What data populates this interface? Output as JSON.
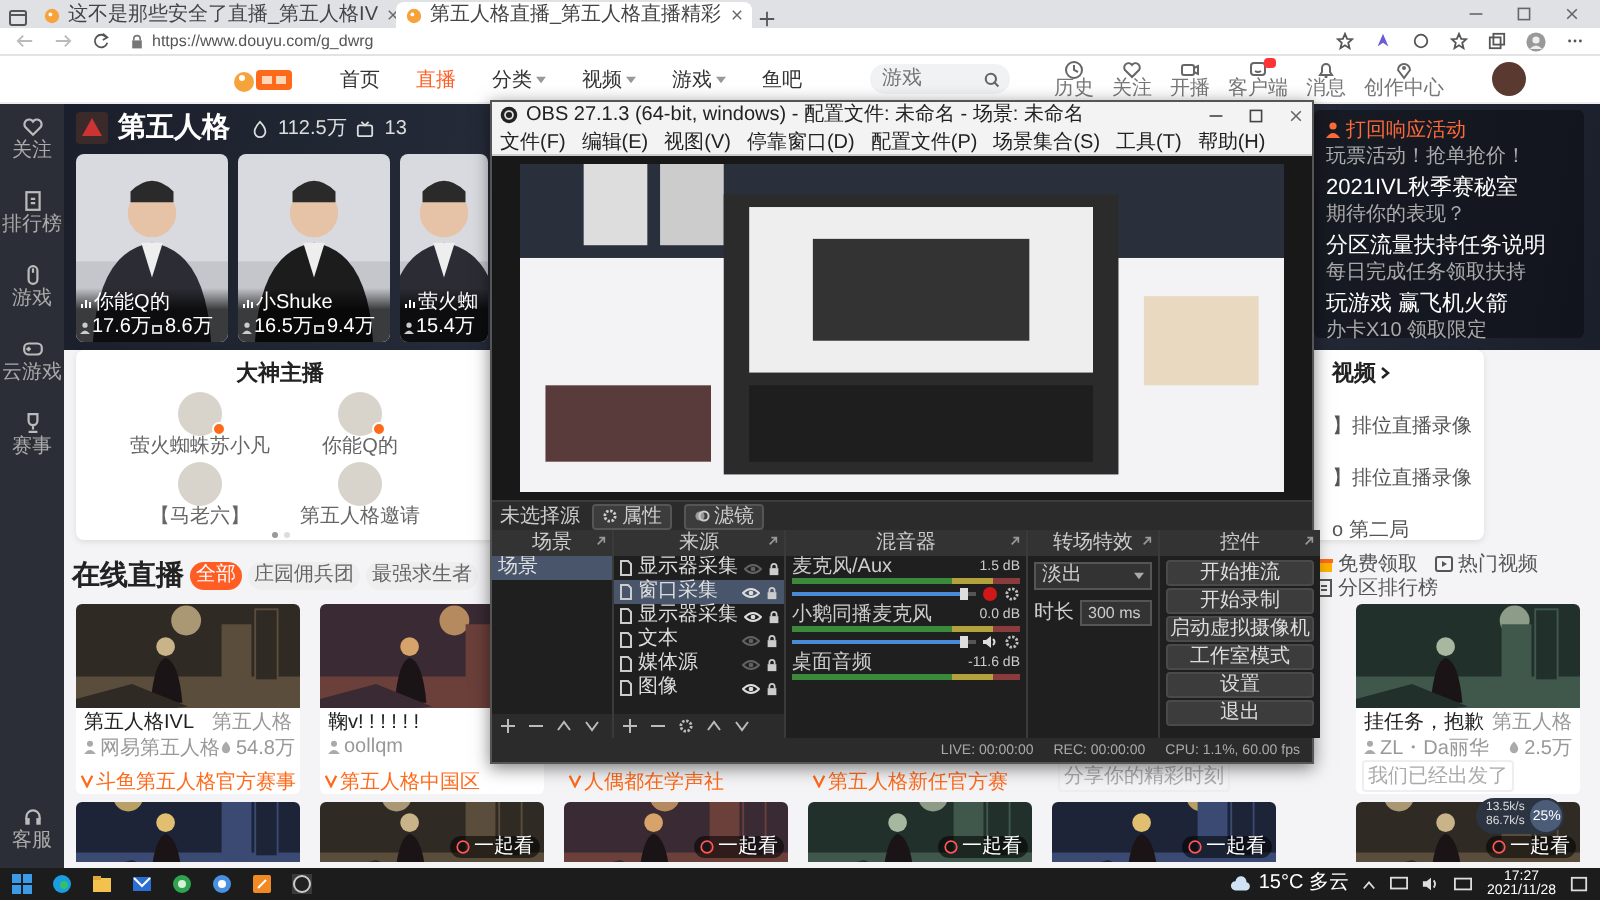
{
  "browser": {
    "tabs": [
      {
        "title": "这不是那些安全了直播_第五人格IV",
        "selected": false
      },
      {
        "title": "第五人格直播_第五人格直播精彩",
        "selected": true
      }
    ],
    "url": "https://www.douyu.com/g_dwrg"
  },
  "site_header": {
    "nav": [
      {
        "label": "首页",
        "selected": false,
        "dropdown": false
      },
      {
        "label": "直播",
        "selected": true,
        "dropdown": false
      },
      {
        "label": "分类",
        "selected": false,
        "dropdown": true
      },
      {
        "label": "视频",
        "selected": false,
        "dropdown": true
      },
      {
        "label": "游戏",
        "selected": false,
        "dropdown": true
      },
      {
        "label": "鱼吧",
        "selected": false,
        "dropdown": false
      }
    ],
    "search": {
      "placeholder": "游戏"
    },
    "tools": [
      {
        "label": "历史",
        "badge": false
      },
      {
        "label": "关注",
        "badge": false
      },
      {
        "label": "开播",
        "badge": false
      },
      {
        "label": "客户端",
        "badge": true
      },
      {
        "label": "消息",
        "badge": false
      },
      {
        "label": "创作中心",
        "badge": false
      }
    ]
  },
  "sidebar": {
    "items": [
      {
        "label": "关注"
      },
      {
        "label": "排行榜"
      },
      {
        "label": "游戏"
      },
      {
        "label": "云游戏"
      },
      {
        "label": "赛事"
      }
    ],
    "footer": {
      "label": "客服"
    }
  },
  "banner": {
    "title": "第五人格",
    "heat": "112.5万",
    "rooms": "13",
    "stars": [
      {
        "name": "你能Q的",
        "followers": "17.6万",
        "gifts": "8.6万"
      },
      {
        "name": "小Shuke",
        "followers": "16.5万",
        "gifts": "9.4万"
      },
      {
        "name": "萤火蜘",
        "followers": "15.4万"
      }
    ],
    "news": {
      "title": "打回响应活动",
      "subtitle": "玩票活动！抢单抢价！",
      "items": [
        {
          "title": "2021IVL秋季赛秘室",
          "subtitle": "期待你的表现？"
        },
        {
          "title": "分区流量扶持任务说明",
          "subtitle": "每日完成任务领取扶持"
        },
        {
          "title": "玩游戏 赢飞机火箭",
          "subtitle": "办卡X10 领取限定"
        }
      ]
    }
  },
  "masters": {
    "title": "大神主播",
    "streamers": [
      {
        "name": "萤火蜘蛛苏小凡",
        "live": true
      },
      {
        "name": "你能Q的",
        "live": true
      },
      {
        "name": "【马老六】",
        "live": false
      },
      {
        "name": "第五人格邀请",
        "live": false
      }
    ],
    "pages": [
      {
        "selected": true
      },
      {
        "selected": false
      }
    ]
  },
  "videos": {
    "title": "视频",
    "items": [
      "】排位直播录像",
      "】排位直播录像",
      "o 第二局"
    ]
  },
  "live": {
    "title": "在线直播",
    "filters": [
      {
        "label": "全部",
        "selected": true
      },
      {
        "label": "庄园佣兵团",
        "selected": false
      },
      {
        "label": "最强求生者",
        "selected": false
      }
    ],
    "links": [
      {
        "label": "免费领取"
      },
      {
        "label": "热门视频"
      },
      {
        "label": "分区排行榜"
      }
    ],
    "rooms": [
      {
        "title": "第五人格IVL",
        "category": "第五人格",
        "streamer": "网易第五人格",
        "viewers": "54.8万",
        "tag": "斗鱼第五人格官方赛事"
      },
      {
        "title": "鞠v! ! ! ! ! !",
        "streamer": "oollqm",
        "tag": "第五人格中国区"
      },
      {
        "tag": "人偶都在学声社"
      },
      {
        "tag": "第五人格新任官方赛"
      },
      {
        "note": "分享你的精彩时刻"
      },
      {
        "title": "挂任务，抱歉",
        "category": "第五人格",
        "streamer": "ZL・Da丽华",
        "viewers": "2.5万",
        "note": "我们已经出发了"
      }
    ],
    "more_rooms": [
      {
        "kind": "picture"
      },
      {
        "kind": "picture",
        "action": "一起看"
      },
      {
        "kind": "picture",
        "action": "一起看"
      },
      {
        "kind": "picture",
        "action": "一起看"
      },
      {
        "kind": "picture",
        "action": "一起看"
      },
      {
        "kind": "picture",
        "action": "一起看"
      }
    ]
  },
  "obs": {
    "title": "OBS 27.1.3 (64-bit, windows) - 配置文件: 未命名 - 场景: 未命名",
    "menu": [
      "文件(F)",
      "编辑(E)",
      "视图(V)",
      "停靠窗口(D)",
      "配置文件(P)",
      "场景集合(S)",
      "工具(T)",
      "帮助(H)"
    ],
    "source_bar": {
      "label": "未选择源",
      "buttons": [
        "属性",
        "滤镜"
      ]
    },
    "scenes": {
      "title": "场景",
      "items": [
        {
          "name": "场景",
          "selected": true
        }
      ]
    },
    "sources": {
      "title": "来源",
      "items": [
        {
          "name": "显示器采集",
          "selected": false,
          "visible": false
        },
        {
          "name": "窗口采集",
          "selected": true,
          "visible": true
        },
        {
          "name": "显示器采集",
          "selected": false,
          "visible": true
        },
        {
          "name": "文本",
          "selected": false,
          "visible": false
        },
        {
          "name": "媒体源",
          "selected": false,
          "visible": false
        },
        {
          "name": "图像",
          "selected": false,
          "visible": true
        }
      ]
    },
    "mixer": {
      "title": "混音器",
      "channels": [
        {
          "name": "麦克风/Aux",
          "reading": "1.5 dB",
          "level": 0.93,
          "muted": true
        },
        {
          "name": "小鹅同播麦克风",
          "reading": "0.0 dB",
          "level": 0.93,
          "muted": false
        },
        {
          "name": "桌面音频",
          "reading": "-11.6 dB"
        }
      ]
    },
    "transitions": {
      "title": "转场特效",
      "value": "淡出",
      "duration_label": "时长",
      "duration": "300 ms"
    },
    "controls": {
      "title": "控件",
      "buttons": [
        "开始推流",
        "开始录制",
        "启动虚拟摄像机",
        "工作室模式",
        "设置",
        "退出"
      ]
    },
    "status": [
      "LIVE: 00:00:00",
      "REC: 00:00:00",
      "CPU: 1.1%, 60.00 fps"
    ]
  },
  "net_widget": {
    "percent": "25%",
    "up": "13.5k/s",
    "down": "86.7k/s"
  },
  "taskbar": {
    "weather": "15°C 多云",
    "time": "17:27",
    "date": "2021/11/28"
  }
}
